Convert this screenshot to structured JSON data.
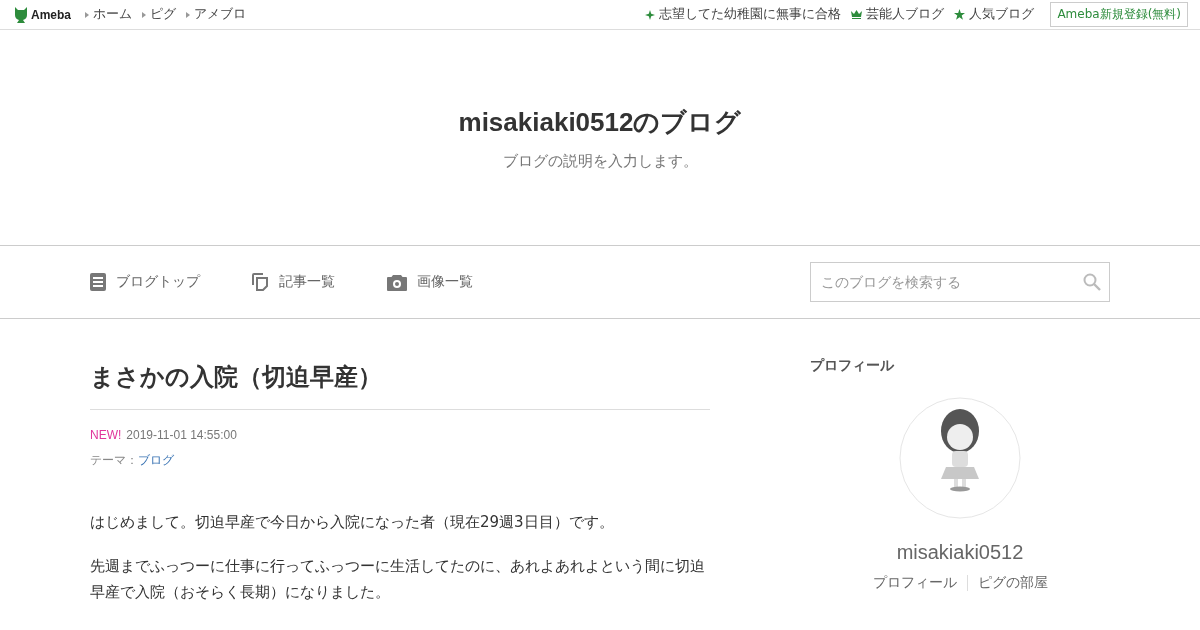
{
  "topbar": {
    "logo": "Ameba",
    "nav": [
      {
        "label": "ホーム"
      },
      {
        "label": "ピグ"
      },
      {
        "label": "アメブロ"
      }
    ],
    "links": [
      {
        "kind": "sparkle",
        "label": "志望してた幼稚園に無事に合格"
      },
      {
        "kind": "crown",
        "label": "芸能人ブログ"
      },
      {
        "kind": "star",
        "label": "人気ブログ"
      }
    ],
    "signup": "Ameba新規登録(無料)"
  },
  "header": {
    "title": "misakiaki0512のブログ",
    "description": "ブログの説明を入力します。"
  },
  "menu": [
    {
      "kind": "doc",
      "label": "ブログトップ"
    },
    {
      "kind": "copy",
      "label": "記事一覧"
    },
    {
      "kind": "camera",
      "label": "画像一覧"
    }
  ],
  "search": {
    "placeholder": "このブログを検索する"
  },
  "article": {
    "title": "まさかの入院（切迫早産）",
    "new_badge": "NEW!",
    "date": "2019-11-01 14:55:00",
    "theme_label": "テーマ：",
    "theme": "ブログ",
    "paragraphs": [
      "はじめまして。切迫早産で今日から入院になった者（現在29週3日目）です。",
      "先週までふっつーに仕事に行ってふっつーに生活してたのに、あれよあれよという間に切迫早産で入院（おそらく長期）になりました。"
    ]
  },
  "sidebar": {
    "heading": "プロフィール",
    "name": "misakiaki0512",
    "links": [
      {
        "label": "プロフィール"
      },
      {
        "label": "ピグの部屋"
      }
    ]
  }
}
